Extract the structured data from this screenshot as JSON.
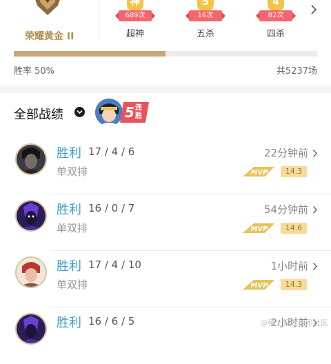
{
  "rank": {
    "name": "荣耀黄金 II",
    "emblem_icon": "gold-rank-emblem",
    "stats": [
      {
        "icon_char": "神",
        "count": "689次",
        "label": "超神"
      },
      {
        "icon_char": "5",
        "count": "16次",
        "label": "五杀"
      },
      {
        "icon_char": "4",
        "count": "82次",
        "label": "四杀"
      }
    ],
    "win_rate_label": "胜率 50%",
    "win_rate_value": 0.5,
    "total_label": "共5237场"
  },
  "section": {
    "title": "全部战绩",
    "streak_num": "5",
    "streak_text": "连胜"
  },
  "matches": [
    {
      "result": "胜利",
      "kda": "17 / 4 / 6",
      "mode": "单双排",
      "time": "22分钟前",
      "score": "14.3",
      "mvp": true,
      "hero": "dark-warrior"
    },
    {
      "result": "胜利",
      "kda": "16 / 0 / 7",
      "mode": "单双排",
      "time": "54分钟前",
      "score": "14.6",
      "mvp": true,
      "hero": "purple-mage"
    },
    {
      "result": "胜利",
      "kda": "17 / 4 / 10",
      "mode": "单双排",
      "time": "1小时前",
      "score": "14.3",
      "mvp": true,
      "hero": "red-hair-fighter"
    },
    {
      "result": "胜利",
      "kda": "16 / 6 / 5",
      "mode": "",
      "time": "2小时前",
      "score": "",
      "mvp": false,
      "hero": "purple-mage"
    }
  ],
  "watermark": "@稀土掘金技术社区",
  "colors": {
    "accent_blue": "#3d9ccd",
    "gold": "#c6a97b",
    "mvp_gold": "#e6c25a",
    "streak_red": "#e8545b"
  }
}
